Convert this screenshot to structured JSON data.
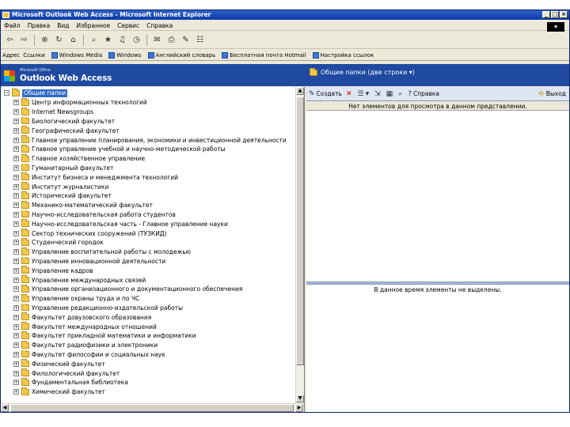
{
  "window": {
    "title": "Microsoft Outlook Web Access - Microsoft Internet Explorer",
    "controls": [
      "_",
      "□",
      "×"
    ]
  },
  "menubar": {
    "items": [
      "Файл",
      "Правка",
      "Вид",
      "Избранное",
      "Сервис",
      "Справка"
    ]
  },
  "toolbar": {
    "icons": [
      "back-icon",
      "forward-icon",
      "stop-icon",
      "refresh-icon",
      "home-icon",
      "search-icon",
      "favorites-icon",
      "media-icon",
      "history-icon",
      "mail-icon",
      "print-icon",
      "edit-icon",
      "discuss-icon"
    ]
  },
  "linksbar": {
    "label": "Адрес",
    "items": [
      "Ссылки",
      "Windows Media",
      "Windows",
      "Английский словарь",
      "Бесплатная почта Hotmail",
      "Настройка ссылок"
    ]
  },
  "owa": {
    "ms_label": "Microsoft Office",
    "title": "Outlook Web Access",
    "folder_caption": "Общие папки (две строки ▾)"
  },
  "tree": {
    "root": "Общие папки",
    "items": [
      "Центр информационных технологий",
      "Internet Newsgroups",
      "Биологический факультет",
      "Географический факультет",
      "Главное управление планирования, экономики и инвестиционной деятельности",
      "Главное управление учебной и научно-методической работы",
      "Главное хозяйственное управление",
      "Гуманитарный факультет",
      "Институт бизнеса и менеджмента технологий",
      "Институт журналистики",
      "Исторический факультет",
      "Механико-математический факультет",
      "Научно-исследовательская работа студентов",
      "Научно-исследовательская часть - Главное управление науки",
      "Сектор технических сооружений (ТУЗКИД)",
      "Студенческий городок",
      "Управление воспитательной работы с молодежью",
      "Управление инновационной деятельности",
      "Управление кадров",
      "Управление международных связей",
      "Управление организационного и документационного обеспечения",
      "Управление охраны труда и по ЧС",
      "Управление редакционно-издательской работы",
      "Факультет довузовского образования",
      "Факультет международных отношений",
      "Факультет прикладной математики и информатики",
      "Факультет радиофизики и электроники",
      "Факультет философии и социальных наук",
      "Физический факультет",
      "Филологический факультет",
      "Фундаментальная библиотека",
      "Химический факультет"
    ]
  },
  "reading": {
    "new_label": "Создать",
    "help_label": "Справка",
    "exit_label": "Выход",
    "empty_message": "Нет элементов для просмотра в данном представлении.",
    "preview_message": "В данное время элементы не выделены."
  }
}
